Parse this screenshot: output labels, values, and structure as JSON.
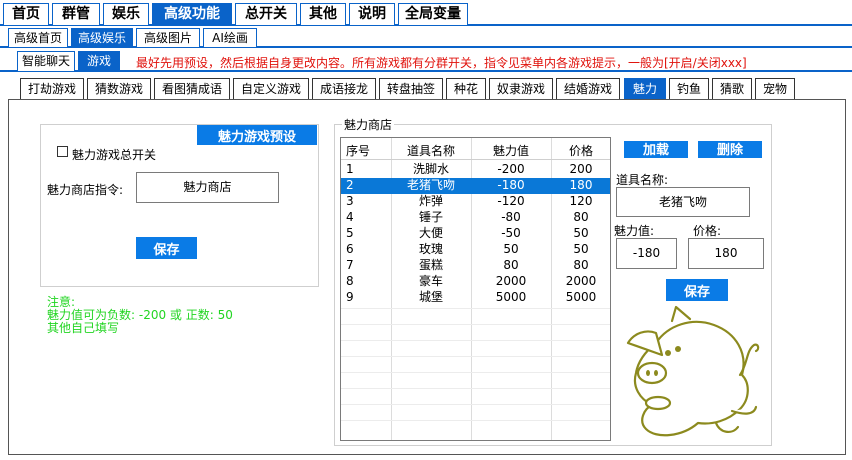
{
  "top_tabs": [
    "首页",
    "群管",
    "娱乐",
    "高级功能",
    "总开关",
    "其他",
    "说明",
    "全局变量"
  ],
  "second_tabs": [
    "高级首页",
    "高级娱乐",
    "高级图片",
    "AI绘画"
  ],
  "third_tabs": [
    "智能聊天",
    "游戏"
  ],
  "notice": "最好先用预设，然后根据自身更改内容。所有游戏都有分群开关，指令见菜单内各游戏提示，一般为[开启/关闭xxx]",
  "game_tabs": [
    "打劫游戏",
    "猜数游戏",
    "看图猜成语",
    "自定义游戏",
    "成语接龙",
    "转盘抽签",
    "种花",
    "奴隶游戏",
    "结婚游戏",
    "魅力",
    "钓鱼",
    "猜歌",
    "宠物"
  ],
  "left": {
    "preset_button": "魅力游戏预设",
    "master_switch_label": "魅力游戏总开关",
    "shop_command_label": "魅力商店指令:",
    "shop_command_value": "魅力商店",
    "save_button": "保存"
  },
  "note": {
    "title": "注意:",
    "line1": "魅力值可为负数: -200 或 正数: 50",
    "line2": "其他自己填写"
  },
  "shop": {
    "title": "魅力商店",
    "columns": [
      "序号",
      "道具名称",
      "魅力值",
      "价格"
    ],
    "rows": [
      [
        "1",
        "洗脚水",
        "-200",
        "200"
      ],
      [
        "2",
        "老猪飞吻",
        "-180",
        "180"
      ],
      [
        "3",
        "炸弹",
        "-120",
        "120"
      ],
      [
        "4",
        "锤子",
        "-80",
        "80"
      ],
      [
        "5",
        "大便",
        "-50",
        "50"
      ],
      [
        "6",
        "玫瑰",
        "50",
        "50"
      ],
      [
        "7",
        "蛋糕",
        "80",
        "80"
      ],
      [
        "8",
        "豪车",
        "2000",
        "2000"
      ],
      [
        "9",
        "城堡",
        "5000",
        "5000"
      ]
    ],
    "selected_row": 1
  },
  "editor": {
    "add_button": "加载",
    "delete_button": "删除",
    "item_name_label": "道具名称:",
    "item_name_value": "老猪飞吻",
    "charm_label": "魅力值:",
    "charm_value": "-180",
    "price_label": "价格:",
    "price_value": "180",
    "save_button": "保存"
  },
  "colors": {
    "accent": "#0a63c9",
    "button": "#0a7be6",
    "notice": "#e0120c",
    "note": "#22d522",
    "pig": "#8c8a1e"
  },
  "icons": {
    "pig": "pig-illustration"
  }
}
